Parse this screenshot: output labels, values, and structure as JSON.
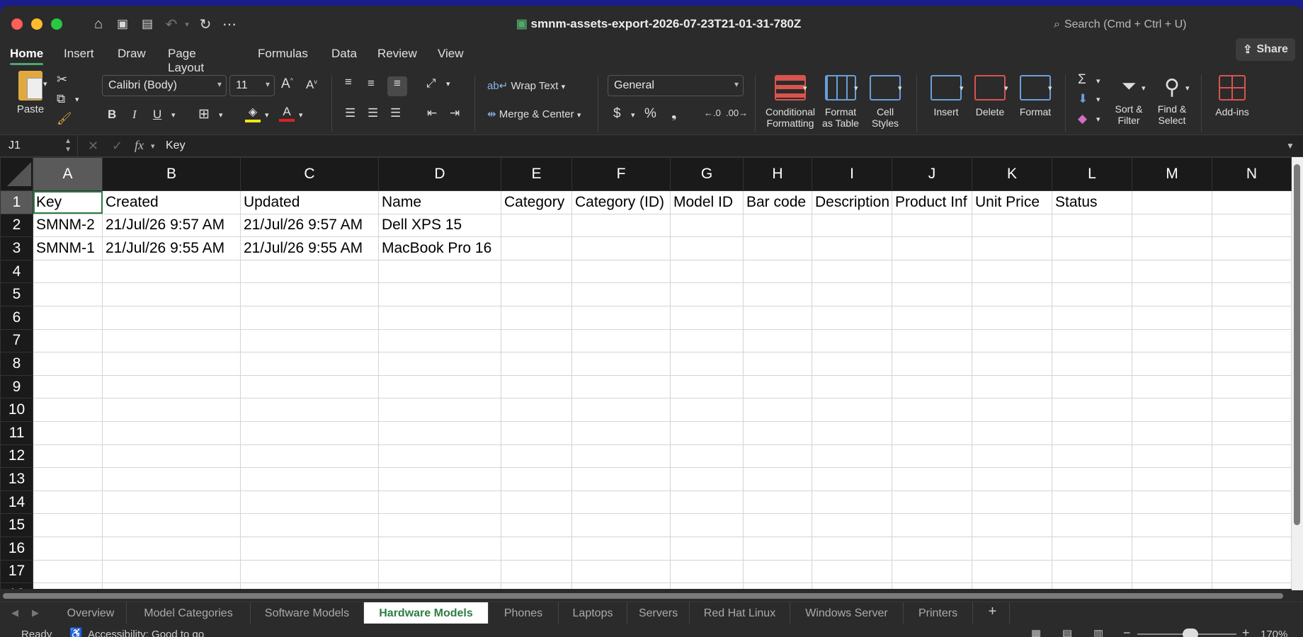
{
  "window": {
    "title": "smnm-assets-export-2026-07-23T21-01-31-780Z",
    "search_placeholder": "Search (Cmd + Ctrl + U)"
  },
  "ribbon_tabs": [
    "Home",
    "Insert",
    "Draw",
    "Page Layout",
    "Formulas",
    "Data",
    "Review",
    "View"
  ],
  "share_label": "Share",
  "ribbon": {
    "paste": "Paste",
    "font_name": "Calibri (Body)",
    "font_size": "11",
    "wrap_text": "Wrap Text",
    "merge_center": "Merge & Center",
    "number_format": "General",
    "conditional_formatting": [
      "Conditional",
      "Formatting"
    ],
    "format_as_table": [
      "Format",
      "as Table"
    ],
    "cell_styles": [
      "Cell",
      "Styles"
    ],
    "insert": "Insert",
    "delete": "Delete",
    "format": "Format",
    "sort_filter": [
      "Sort &",
      "Filter"
    ],
    "find_select": [
      "Find &",
      "Select"
    ],
    "addins": "Add-ins"
  },
  "formula_bar": {
    "cell_ref": "J1",
    "fx": "fx",
    "value": "Key"
  },
  "columns": [
    "A",
    "B",
    "C",
    "D",
    "E",
    "F",
    "G",
    "H",
    "I",
    "J",
    "K",
    "L",
    "M",
    "N"
  ],
  "rows": [
    [
      "Key",
      "Created",
      "Updated",
      "Name",
      "Category",
      "Category (ID)",
      "Model ID",
      "Bar code",
      "Description",
      "Product Inf",
      "Unit Price",
      "Status",
      "",
      ""
    ],
    [
      "SMNM-2",
      "21/Jul/26 9:57 AM",
      "21/Jul/26 9:57 AM",
      "Dell XPS 15",
      "",
      "",
      "",
      "",
      "",
      "",
      "",
      "",
      "",
      ""
    ],
    [
      "SMNM-1",
      "21/Jul/26 9:55 AM",
      "21/Jul/26 9:55 AM",
      "MacBook Pro 16",
      "",
      "",
      "",
      "",
      "",
      "",
      "",
      "",
      "",
      ""
    ],
    [
      "",
      "",
      "",
      "",
      "",
      "",
      "",
      "",
      "",
      "",
      "",
      "",
      "",
      ""
    ],
    [
      "",
      "",
      "",
      "",
      "",
      "",
      "",
      "",
      "",
      "",
      "",
      "",
      "",
      ""
    ],
    [
      "",
      "",
      "",
      "",
      "",
      "",
      "",
      "",
      "",
      "",
      "",
      "",
      "",
      ""
    ],
    [
      "",
      "",
      "",
      "",
      "",
      "",
      "",
      "",
      "",
      "",
      "",
      "",
      "",
      ""
    ],
    [
      "",
      "",
      "",
      "",
      "",
      "",
      "",
      "",
      "",
      "",
      "",
      "",
      "",
      ""
    ],
    [
      "",
      "",
      "",
      "",
      "",
      "",
      "",
      "",
      "",
      "",
      "",
      "",
      "",
      ""
    ],
    [
      "",
      "",
      "",
      "",
      "",
      "",
      "",
      "",
      "",
      "",
      "",
      "",
      "",
      ""
    ],
    [
      "",
      "",
      "",
      "",
      "",
      "",
      "",
      "",
      "",
      "",
      "",
      "",
      "",
      ""
    ],
    [
      "",
      "",
      "",
      "",
      "",
      "",
      "",
      "",
      "",
      "",
      "",
      "",
      "",
      ""
    ],
    [
      "",
      "",
      "",
      "",
      "",
      "",
      "",
      "",
      "",
      "",
      "",
      "",
      "",
      ""
    ],
    [
      "",
      "",
      "",
      "",
      "",
      "",
      "",
      "",
      "",
      "",
      "",
      "",
      "",
      ""
    ],
    [
      "",
      "",
      "",
      "",
      "",
      "",
      "",
      "",
      "",
      "",
      "",
      "",
      "",
      ""
    ],
    [
      "",
      "",
      "",
      "",
      "",
      "",
      "",
      "",
      "",
      "",
      "",
      "",
      "",
      ""
    ],
    [
      "",
      "",
      "",
      "",
      "",
      "",
      "",
      "",
      "",
      "",
      "",
      "",
      "",
      ""
    ],
    [
      "",
      "",
      "",
      "",
      "",
      "",
      "",
      "",
      "",
      "",
      "",
      "",
      "",
      ""
    ]
  ],
  "sheet_tabs": [
    "Overview",
    "Model Categories",
    "Software Models",
    "Hardware Models",
    "Phones",
    "Laptops",
    "Servers",
    "Red Hat Linux",
    "Windows Server",
    "Printers"
  ],
  "active_sheet": "Hardware Models",
  "status": {
    "ready": "Ready",
    "accessibility": "Accessibility: Good to go",
    "zoom": "170%"
  },
  "colors": {
    "accent": "#2e7d46",
    "header_bg": "#1a1a1a",
    "chrome_bg": "#2b2b2b"
  }
}
